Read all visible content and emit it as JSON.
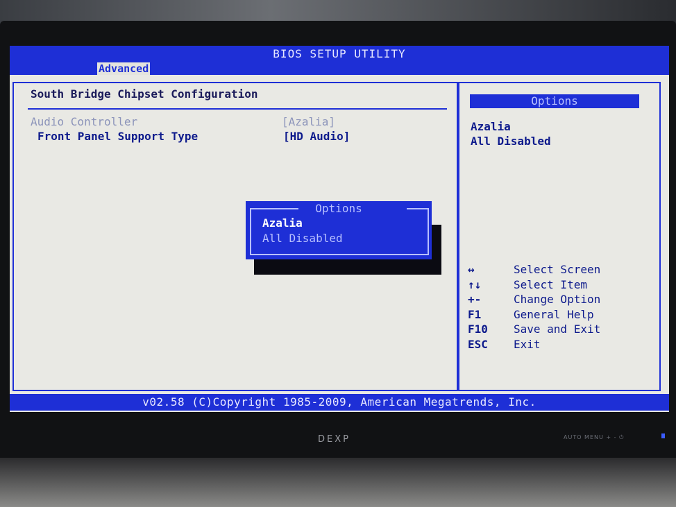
{
  "bios": {
    "title": "BIOS SETUP UTILITY",
    "tabs": [
      {
        "label": "Advanced",
        "active": true
      }
    ],
    "section_title": "South Bridge Chipset Configuration",
    "settings": [
      {
        "label": "Audio Controller",
        "value": "[Azalia]"
      },
      {
        "label": "Front Panel Support Type",
        "value": "[HD Audio]"
      }
    ],
    "help_panel": {
      "header": "Options",
      "options": [
        "Azalia",
        "All Disabled"
      ]
    },
    "keys": [
      {
        "key": "↔",
        "desc": "Select Screen"
      },
      {
        "key": "↑↓",
        "desc": "Select Item"
      },
      {
        "key": "+-",
        "desc": "Change Option"
      },
      {
        "key": "F1",
        "desc": "General Help"
      },
      {
        "key": "F10",
        "desc": "Save and Exit"
      },
      {
        "key": "ESC",
        "desc": "Exit"
      }
    ],
    "popup": {
      "title": "Options",
      "items": [
        "Azalia",
        "All Disabled"
      ],
      "selected": "Azalia"
    },
    "footer": "v02.58 (C)Copyright 1985-2009, American Megatrends, Inc."
  },
  "monitor": {
    "brand": "DEXP",
    "controls": "AUTO  MENU   +   -   ⏻"
  },
  "colors": {
    "bios_blue": "#1e2fd6",
    "screen_bg": "#e9e9e4",
    "text_dark_blue": "#0d1a8c",
    "text_dim": "#8c94ba"
  }
}
